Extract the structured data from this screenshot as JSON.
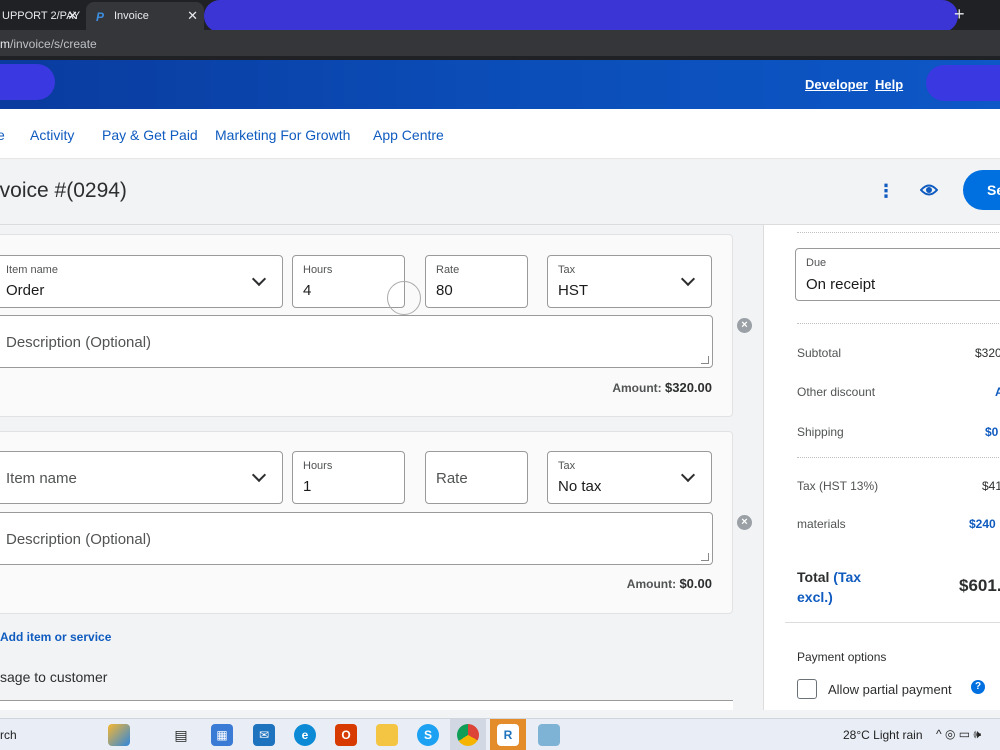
{
  "browser": {
    "tabs": [
      {
        "label": "UPPORT 2/PAY",
        "close": "✕"
      },
      {
        "label": "Invoice",
        "close": "✕"
      }
    ],
    "new_tab": "+",
    "url_host": "m",
    "url_path": "/invoice/s/create"
  },
  "header": {
    "links": [
      "Developer",
      "Help"
    ]
  },
  "nav": {
    "items": [
      "e",
      "Activity",
      "Pay & Get Paid",
      "Marketing For Growth",
      "App Centre"
    ]
  },
  "titlebar": {
    "title": "nvoice #(0294)",
    "more_icon": "⋮",
    "send_label": "Se"
  },
  "items": [
    {
      "item_name_label": "Item name",
      "item_name_value": "Order",
      "hours_label": "Hours",
      "hours_value": "4",
      "rate_label": "Rate",
      "rate_value": "80",
      "tax_label": "Tax",
      "tax_value": "HST",
      "description_placeholder": "Description (Optional)",
      "amount_label": "Amount:",
      "amount_value": "$320.00"
    },
    {
      "item_name_placeholder": "Item name",
      "hours_label": "Hours",
      "hours_value": "1",
      "rate_placeholder": "Rate",
      "tax_label": "Tax",
      "tax_value": "No tax",
      "description_placeholder": "Description (Optional)",
      "amount_label": "Amount:",
      "amount_value": "$0.00"
    }
  ],
  "add_item": "Add item or service",
  "message_label": "sage to customer",
  "summary": {
    "due_label": "Due",
    "due_value": "On receipt",
    "subtotal_label": "Subtotal",
    "subtotal_value": "$320",
    "other_discount_label": "Other discount",
    "other_discount_value": "A",
    "shipping_label": "Shipping",
    "shipping_value": "$0",
    "tax_label": "Tax (HST 13%)",
    "tax_value": "$41",
    "materials_label": "materials",
    "materials_value": "$240",
    "total_label": "Total",
    "total_note": "(Tax excl.)",
    "total_value": "$601.",
    "payment_options_label": "Payment options",
    "partial_payment_label": "Allow partial payment",
    "help_icon": "?"
  },
  "taskbar": {
    "search_text": "rch",
    "weather": "28°C  Light rain"
  },
  "colors": {
    "brand_blue": "#0070e0",
    "link_blue": "#0f5bbf",
    "header_blue": "#0b4db8"
  }
}
